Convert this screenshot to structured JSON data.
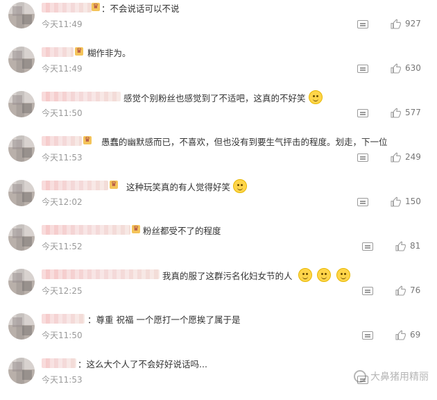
{
  "comments": [
    {
      "text": "：不会说话可以不说",
      "time": "今天11:49",
      "likes": "927"
    },
    {
      "text": "糊作非为。",
      "time": "今天11:49",
      "likes": "630"
    },
    {
      "text": "感觉个别粉丝也感觉到了不适吧，这真的不好笑",
      "time": "今天11:50",
      "likes": "577"
    },
    {
      "text": "愚蠢的幽默感而已，不喜欢，但也没有到要生气抨击的程度。划走，下一位",
      "time": "今天11:53",
      "likes": "249"
    },
    {
      "text": "这种玩笑真的有人觉得好笑",
      "time": "今天12:02",
      "likes": "150"
    },
    {
      "text": "粉丝都受不了的程度",
      "time": "今天11:52",
      "likes": "81"
    },
    {
      "text": "我真的服了这群污名化妇女节的人",
      "time": "今天12:25",
      "likes": "76"
    },
    {
      "text": "：尊重 祝福 一个愿打一个愿挨了属于是",
      "time": "今天11:50",
      "likes": "69"
    },
    {
      "text": "：这么大个人了不会好好说话吗...",
      "time": "今天11:53",
      "likes": ""
    }
  ],
  "watermark": "大鼻猪用精丽",
  "icons": {
    "reply": "comment-icon",
    "like": "thumbs-up-icon",
    "emoji": "smile-emoji-icon"
  }
}
